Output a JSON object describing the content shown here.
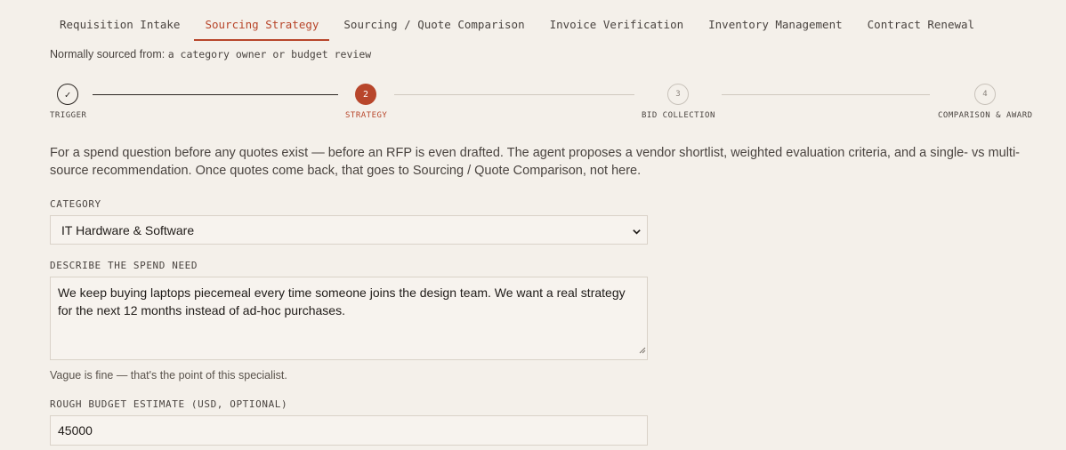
{
  "tabs": [
    {
      "label": "Requisition Intake",
      "active": false
    },
    {
      "label": "Sourcing Strategy",
      "active": true
    },
    {
      "label": "Sourcing / Quote Comparison",
      "active": false
    },
    {
      "label": "Invoice Verification",
      "active": false
    },
    {
      "label": "Inventory Management",
      "active": false
    },
    {
      "label": "Contract Renewal",
      "active": false
    }
  ],
  "sourced": {
    "prefix": "Normally sourced from:",
    "value": "a category owner or budget review"
  },
  "stepper": {
    "steps": [
      {
        "marker": "✓",
        "label": "TRIGGER",
        "state": "done"
      },
      {
        "marker": "2",
        "label": "STRATEGY",
        "state": "current"
      },
      {
        "marker": "3",
        "label": "BID COLLECTION",
        "state": "todo"
      },
      {
        "marker": "4",
        "label": "COMPARISON & AWARD",
        "state": "todo"
      }
    ]
  },
  "intro": "For a spend question before any quotes exist — before an RFP is even drafted. The agent proposes a vendor shortlist, weighted evaluation criteria, and a single- vs multi-source recommendation. Once quotes come back, that goes to Sourcing / Quote Comparison, not here.",
  "form": {
    "category_label": "CATEGORY",
    "category_value": "IT Hardware & Software",
    "need_label": "DESCRIBE THE SPEND NEED",
    "need_value": "We keep buying laptops piecemeal every time someone joins the design team. We want a real strategy for the next 12 months instead of ad-hoc purchases.",
    "need_hint": "Vague is fine — that's the point of this specialist.",
    "budget_label": "ROUGH BUDGET ESTIMATE (USD, OPTIONAL)",
    "budget_value": "45000"
  },
  "colors": {
    "background": "#f4f0ea",
    "accent": "#b8462b",
    "text": "#2b2622",
    "border": "#d9d2c8"
  },
  "icons": {
    "select_chevron": "chevron-down-icon",
    "resize": "resize-grip-icon",
    "done_step": "check-icon"
  }
}
